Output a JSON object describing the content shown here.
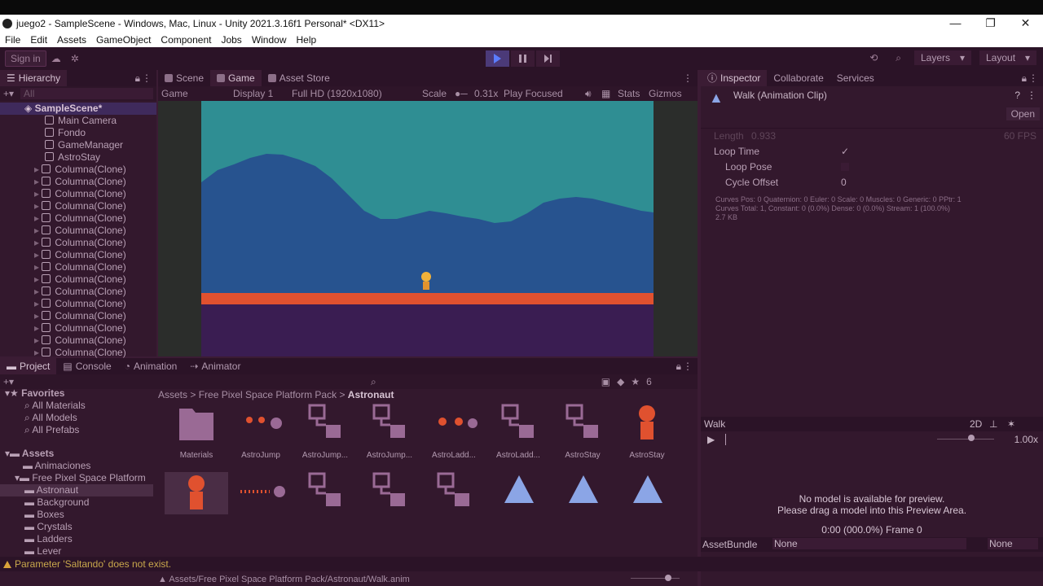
{
  "window": {
    "title": "juego2 - SampleScene - Windows, Mac, Linux - Unity 2021.3.16f1 Personal* <DX11>",
    "controls": [
      "—",
      "❐",
      "✕"
    ]
  },
  "menu": [
    "File",
    "Edit",
    "Assets",
    "GameObject",
    "Component",
    "Jobs",
    "Window",
    "Help"
  ],
  "toolbar": {
    "signin": "Sign in",
    "layers": "Layers",
    "layout": "Layout"
  },
  "hierarchy": {
    "tab": "Hierarchy",
    "search_placeholder": "All",
    "root": "SampleScene*",
    "children": [
      "Main Camera",
      "Fondo",
      "GameManager",
      "AstroStay"
    ],
    "clones": [
      "Columna(Clone)",
      "Columna(Clone)",
      "Columna(Clone)",
      "Columna(Clone)",
      "Columna(Clone)",
      "Columna(Clone)",
      "Columna(Clone)",
      "Columna(Clone)",
      "Columna(Clone)",
      "Columna(Clone)",
      "Columna(Clone)",
      "Columna(Clone)",
      "Columna(Clone)",
      "Columna(Clone)",
      "Columna(Clone)",
      "Columna(Clone)"
    ]
  },
  "sceneTabs": [
    "Scene",
    "Game",
    "Asset Store"
  ],
  "gameBar": {
    "mode": "Game",
    "display": "Display 1",
    "resolution": "Full HD (1920x1080)",
    "scale_label": "Scale",
    "scale_value": "0.31x",
    "play_mode": "Play Focused",
    "stats": "Stats",
    "gizmos": "Gizmos"
  },
  "inspector": {
    "tabs": [
      "Inspector",
      "Collaborate",
      "Services"
    ],
    "title": "Walk (Animation Clip)",
    "open": "Open",
    "length_label": "Length",
    "length_value": "0.933",
    "fps": "60 FPS",
    "loop_time": "Loop Time",
    "loop_time_check": "✓",
    "loop_pose": "Loop Pose",
    "cycle_offset": "Cycle Offset",
    "cycle_offset_value": "0",
    "info1": "Curves Pos: 0 Quaternion: 0 Euler: 0 Scale: 0 Muscles: 0 Generic: 0 PPtr: 1",
    "info2": "Curves Total: 1, Constant: 0 (0.0%) Dense: 0 (0.0%) Stream: 1 (100.0%)",
    "info3": "2.7 KB",
    "preview_name": "Walk",
    "preview_2d": "2D",
    "preview_speed": "1.00x",
    "preview_msg1": "No model is available for preview.",
    "preview_msg2": "Please drag a model into this Preview Area.",
    "preview_time": "0:00 (000.0%) Frame 0",
    "assetbundle_label": "AssetBundle",
    "assetbundle_value": "None",
    "assetbundle_variant": "None"
  },
  "project": {
    "tabs": [
      "Project",
      "Console",
      "Animation",
      "Animator"
    ],
    "hidden_count": "6",
    "favorites": "Favorites",
    "fav_items": [
      "All Materials",
      "All Models",
      "All Prefabs"
    ],
    "assets": "Assets",
    "folders": [
      "Animaciones",
      "Free Pixel Space Platform",
      "Astronaut",
      "Background",
      "Boxes",
      "Crystals",
      "Ladders",
      "Lever"
    ],
    "breadcrumb": [
      "Assets",
      "Free Pixel Space Platform Pack",
      "Astronaut"
    ],
    "row1": [
      "Materials",
      "AstroJump",
      "AstroJump...",
      "AstroJump...",
      "AstroLadd...",
      "AstroLadd...",
      "AstroStay",
      "AstroStay"
    ],
    "path": "Assets/Free Pixel Space Platform Pack/Astronaut/Walk.anim"
  },
  "status": {
    "message": "Parameter 'Saltando' does not exist."
  }
}
